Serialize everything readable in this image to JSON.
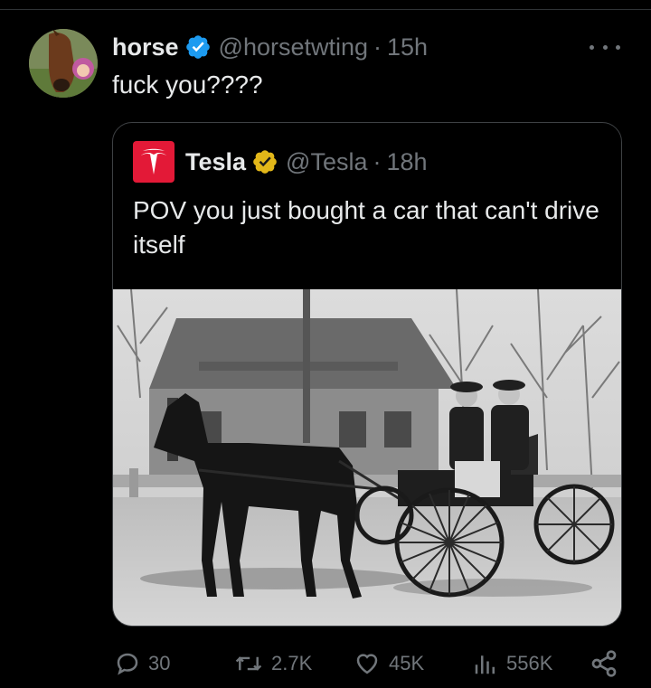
{
  "tweet": {
    "author_name": "horse",
    "author_handle": "@horsetwting",
    "separator": "·",
    "time": "15h",
    "text": "fuck you????"
  },
  "quote": {
    "author_name": "Tesla",
    "author_handle": "@Tesla",
    "separator": "·",
    "time": "18h",
    "text": "POV you just bought a car that can't drive itself"
  },
  "actions": {
    "replies": "30",
    "retweets": "2.7K",
    "likes": "45K",
    "views": "556K"
  },
  "icons": {
    "verified": "verified-badge-icon",
    "verified_gold": "verified-gold-badge-icon",
    "more": "more-icon",
    "reply": "reply-icon",
    "retweet": "retweet-icon",
    "like": "heart-icon",
    "views": "views-chart-icon",
    "share": "share-icon"
  },
  "colors": {
    "background": "#000000",
    "text": "#e7e9ea",
    "muted": "#71767b",
    "verified_blue": "#1d9bf0",
    "verified_gold": "#e2b719",
    "tesla_red": "#e31937"
  }
}
